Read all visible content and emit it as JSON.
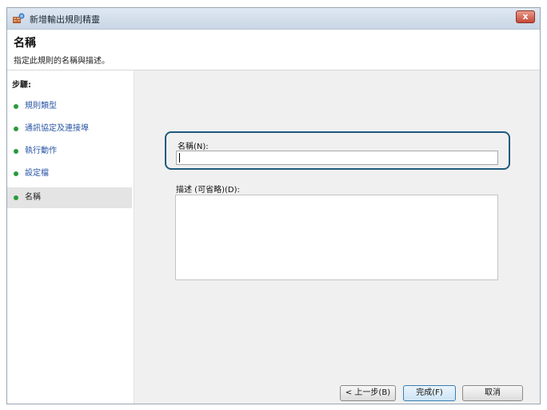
{
  "window": {
    "title": "新增輸出規則精靈",
    "close_label": "x"
  },
  "header": {
    "title": "名稱",
    "subtitle": "指定此規則的名稱與描述。"
  },
  "sidebar": {
    "heading": "步驟:",
    "items": [
      {
        "label": "規則類型"
      },
      {
        "label": "通訊協定及連接埠"
      },
      {
        "label": "執行動作"
      },
      {
        "label": "設定檔"
      },
      {
        "label": "名稱"
      }
    ]
  },
  "form": {
    "name_label": "名稱(N):",
    "name_value": "",
    "description_label": "描述 (可省略)(D):",
    "description_value": ""
  },
  "buttons": {
    "back": "< 上一步(B)",
    "finish": "完成(F)",
    "cancel": "取消"
  }
}
